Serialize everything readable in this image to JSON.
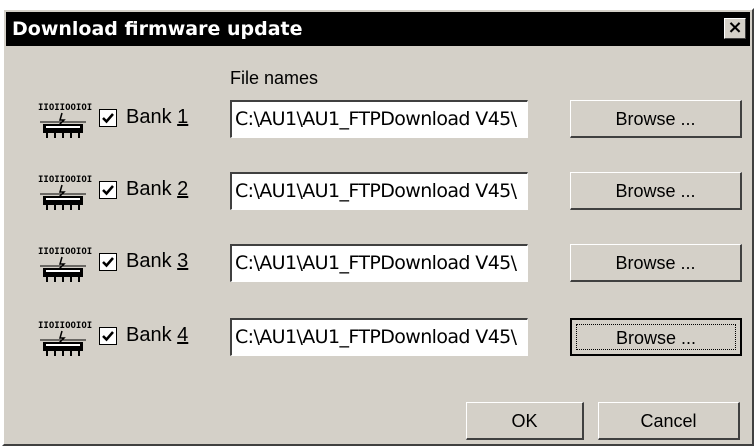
{
  "window": {
    "title": "Download firmware update",
    "close_glyph": "×"
  },
  "header": {
    "file_names_label": "File names"
  },
  "banks": [
    {
      "label_prefix": "Bank ",
      "mnemonic": "1",
      "checked": true,
      "path": "C:\\AU1\\AU1_FTPDownload V45\\",
      "browse_label": "Browse ..."
    },
    {
      "label_prefix": "Bank ",
      "mnemonic": "2",
      "checked": true,
      "path": "C:\\AU1\\AU1_FTPDownload V45\\",
      "browse_label": "Browse ..."
    },
    {
      "label_prefix": "Bank ",
      "mnemonic": "3",
      "checked": true,
      "path": "C:\\AU1\\AU1_FTPDownload V45\\",
      "browse_label": "Browse ..."
    },
    {
      "label_prefix": "Bank ",
      "mnemonic": "4",
      "checked": true,
      "path": "C:\\AU1\\AU1_FTPDownload V45\\",
      "browse_label": "Browse ..."
    }
  ],
  "chip_icon": {
    "name": "firmware-chip-icon",
    "top_text": "IIOIIOOIOI"
  },
  "buttons": {
    "ok": "OK",
    "cancel": "Cancel"
  },
  "colors": {
    "dialog_bg": "#d4d0c8",
    "titlebar_bg": "#000000",
    "titlebar_text": "#ffffff"
  }
}
